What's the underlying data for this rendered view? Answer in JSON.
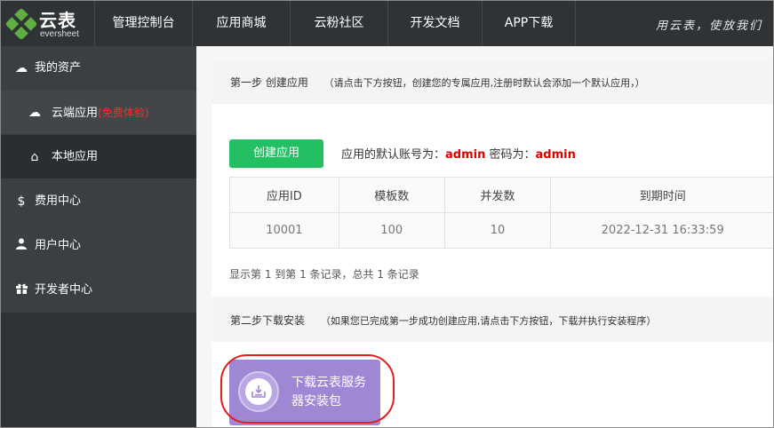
{
  "header": {
    "logo_cn": "云表",
    "logo_en": "eversheet",
    "nav": [
      {
        "label": "管理控制台"
      },
      {
        "label": "应用商城"
      },
      {
        "label": "云粉社区"
      },
      {
        "label": "开发文档"
      },
      {
        "label": "APP下载"
      }
    ],
    "slogan": "用云表，使放我们"
  },
  "sidebar": {
    "items": [
      {
        "label": "我的资产",
        "icon": "cloud-icon"
      },
      {
        "label": "云端应用",
        "tag": "(免费体验)",
        "icon": "cloud-icon"
      },
      {
        "label": "本地应用",
        "icon": "home-icon"
      },
      {
        "label": "费用中心",
        "icon": "dollar-icon"
      },
      {
        "label": "用户中心",
        "icon": "user-icon"
      },
      {
        "label": "开发者中心",
        "icon": "gift-icon"
      }
    ]
  },
  "step1": {
    "title": "第一步 创建应用",
    "note": "（请点击下方按钮，创建您的专属应用,注册时默认会添加一个默认应用，）",
    "create_button": "创建应用",
    "account_prefix": "应用的默认账号为：",
    "account_user": "admin",
    "account_mid": " 密码为：",
    "account_pass": "admin",
    "table": {
      "headers": [
        "应用ID",
        "模板数",
        "并发数",
        "到期时间"
      ],
      "rows": [
        [
          "10001",
          "100",
          "10",
          "2022-12-31 16:33:59"
        ]
      ]
    },
    "records": "显示第 1 到第 1 条记录，总共 1 条记录"
  },
  "step2": {
    "title": "第二步下载安装",
    "note": "（如果您已完成第一步成功创建应用,请点击下方按钮，下载并执行安装程序）",
    "download_button": "下载云表服务器安装包"
  },
  "colors": {
    "topbar": "#2f3335",
    "create_button": "#22c063",
    "download_button": "#a087d4",
    "highlight_ring": "#e01f1f",
    "accent_red": "#e00000"
  }
}
